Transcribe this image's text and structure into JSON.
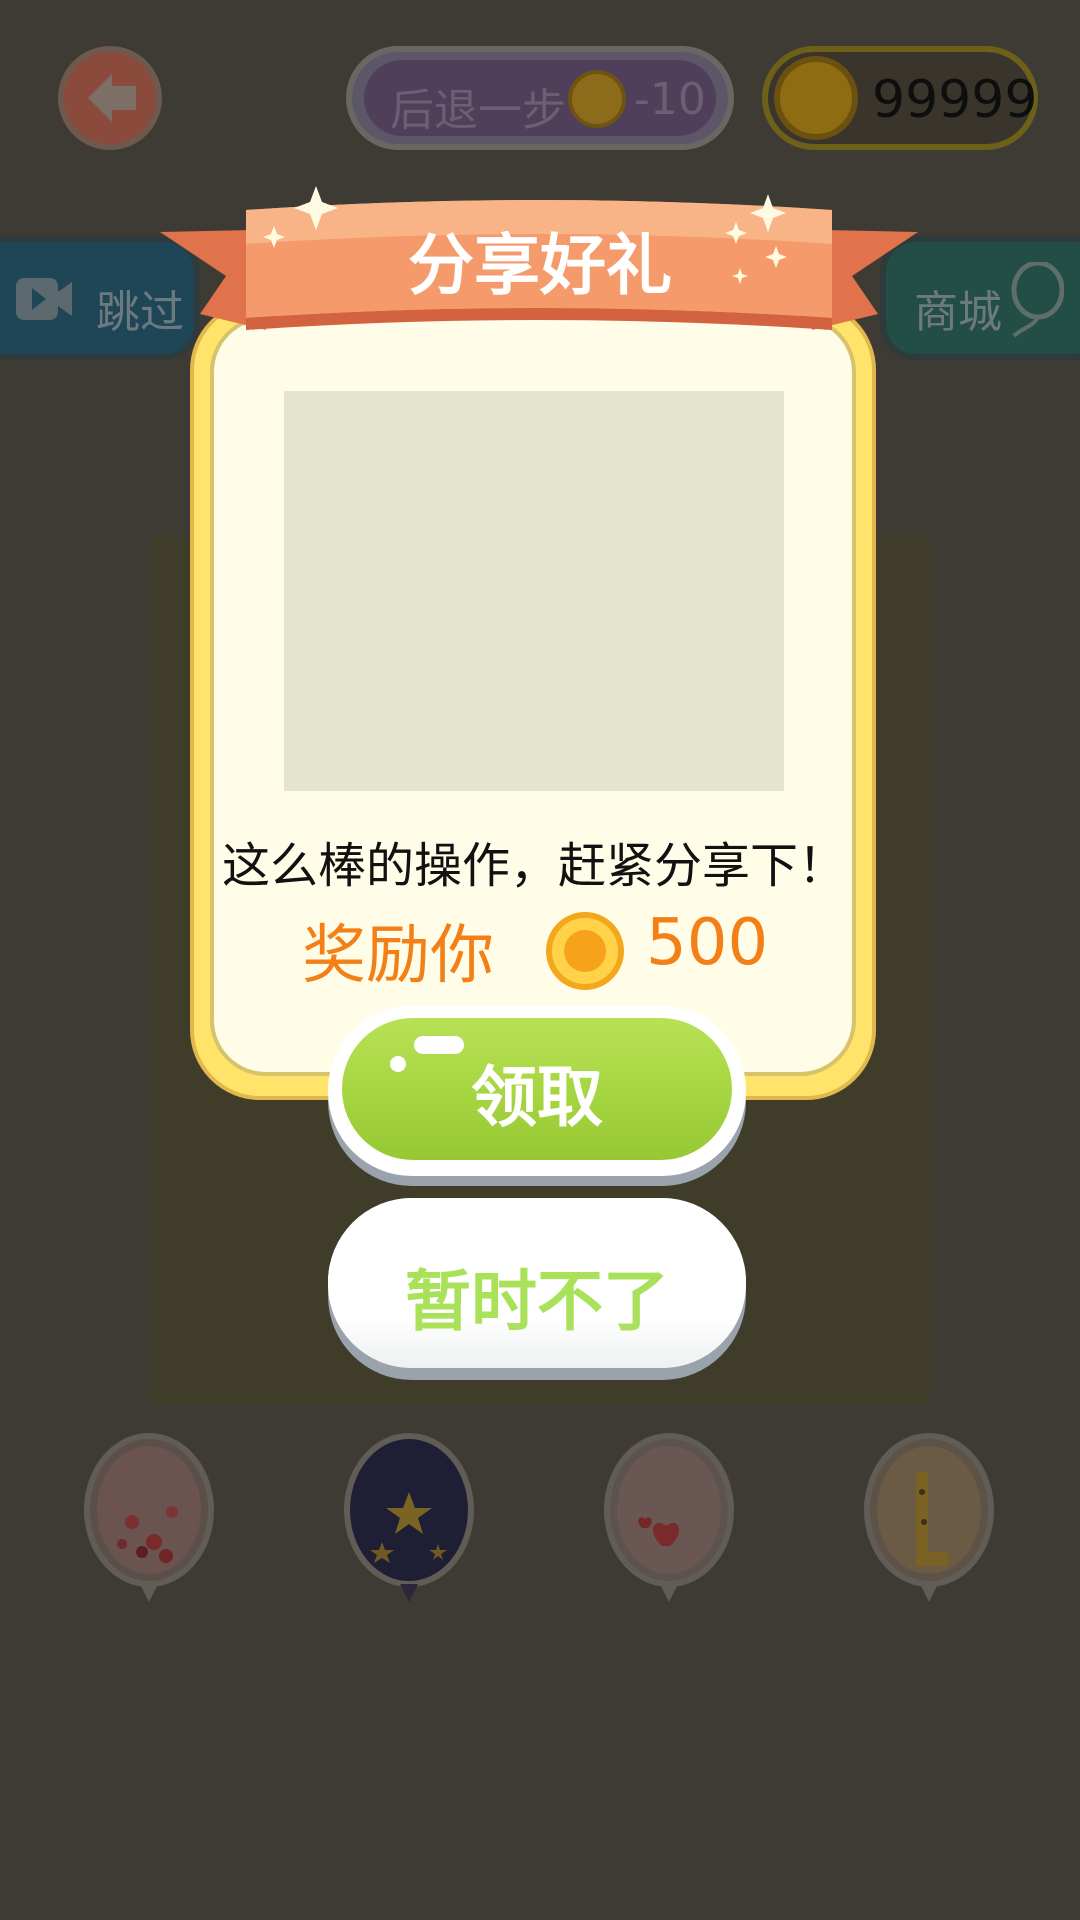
{
  "topbar": {
    "back_icon": "back-arrow-icon",
    "undo_label": "后退一步",
    "undo_cost": "-10",
    "coin_icon": "coin-icon",
    "coin_count": "99999"
  },
  "side_buttons": {
    "skip_label": "跳过",
    "skip_icon": "video-icon",
    "shop_label": "商城",
    "shop_icon": "balloon-icon"
  },
  "balloons": [
    {
      "name": "red-confetti-balloon",
      "color": "#c9a09a"
    },
    {
      "name": "star-balloon",
      "color": "#1e1f35"
    },
    {
      "name": "heart-balloon",
      "color": "#c8a39f"
    },
    {
      "name": "giraffe-balloon",
      "color": "#c79a56"
    }
  ],
  "popup": {
    "title": "分享好礼",
    "message": "这么棒的操作，赶紧分享下！",
    "reward_label": "奖励你",
    "reward_amount": "500",
    "claim_label": "领取",
    "decline_label": "暂时不了"
  },
  "colors": {
    "ribbon": "#f08a5d",
    "card": "#fffde8",
    "accent_orange": "#f37f17",
    "claim_green": "#a5d540",
    "decline_text": "#a9e25a"
  }
}
